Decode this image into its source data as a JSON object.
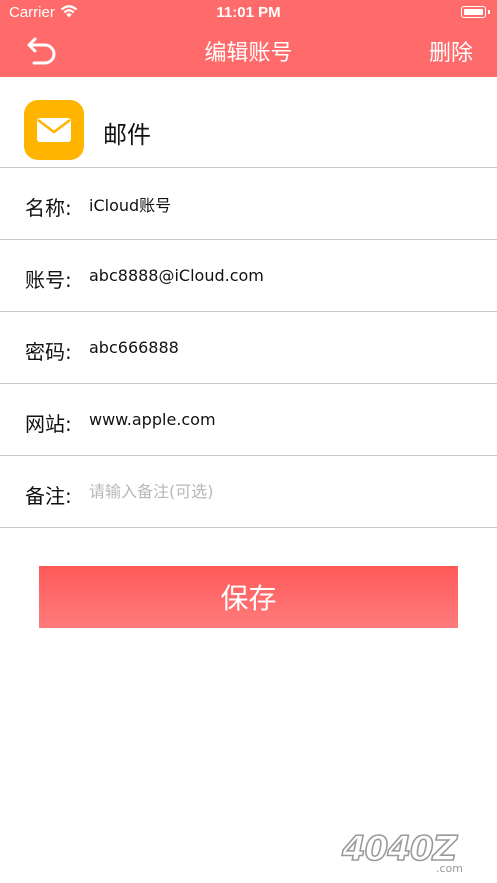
{
  "status_bar": {
    "carrier": "Carrier",
    "time": "11:01 PM"
  },
  "nav": {
    "title": "编辑账号",
    "delete_label": "删除"
  },
  "app": {
    "name": "邮件",
    "icon": "mail-icon",
    "icon_color": "#ffb400"
  },
  "fields": [
    {
      "label": "名称:",
      "value": "iCloud账号",
      "placeholder": ""
    },
    {
      "label": "账号:",
      "value": "abc8888@iCloud.com",
      "placeholder": ""
    },
    {
      "label": "密码:",
      "value": "abc666888",
      "placeholder": ""
    },
    {
      "label": "网站:",
      "value": "www.apple.com",
      "placeholder": ""
    },
    {
      "label": "备注:",
      "value": "",
      "placeholder": "请输入备注(可选)"
    }
  ],
  "save_label": "保存",
  "watermark": "4040Z.com",
  "colors": {
    "accent": "#ff6b6b",
    "button": "#ff6161",
    "divider": "#c8c8c8"
  }
}
